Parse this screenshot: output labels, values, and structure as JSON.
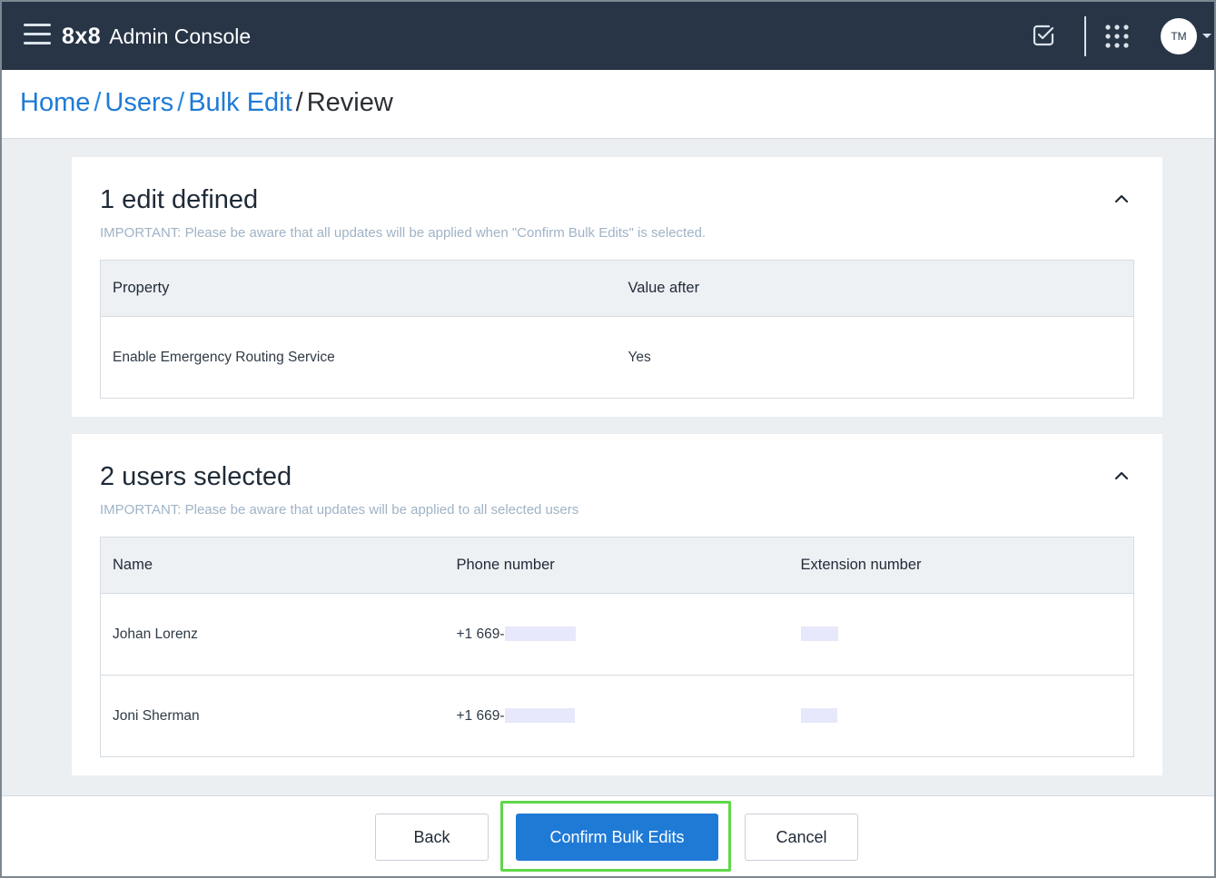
{
  "header": {
    "logo": "8x8",
    "app_name": "Admin Console",
    "avatar_initials": "TM",
    "background": "#273547"
  },
  "breadcrumb": {
    "items": [
      "Home",
      "Users",
      "Bulk Edit"
    ],
    "current": "Review",
    "separator": "/",
    "link_color": "#1f7ad6"
  },
  "edits_card": {
    "title": "1 edit defined",
    "notice": "IMPORTANT: Please be aware that all updates will be applied when \"Confirm Bulk Edits\" is selected.",
    "columns": [
      "Property",
      "Value after"
    ],
    "rows": [
      [
        "Enable Emergency Routing Service",
        "Yes"
      ]
    ]
  },
  "users_card": {
    "title": "2 users selected",
    "notice": "IMPORTANT: Please be aware that updates will be applied to all selected users",
    "columns": [
      "Name",
      "Phone number",
      "Extension number"
    ],
    "rows": [
      {
        "name": "Johan Lorenz",
        "phone_prefix": "+1 669-"
      },
      {
        "name": "Joni Sherman",
        "phone_prefix": "+1 669-"
      }
    ]
  },
  "footer": {
    "back_label": "Back",
    "confirm_label": "Confirm Bulk Edits",
    "cancel_label": "Cancel",
    "primary_color": "#1f7ad6",
    "highlight_color": "#5fd84a"
  }
}
